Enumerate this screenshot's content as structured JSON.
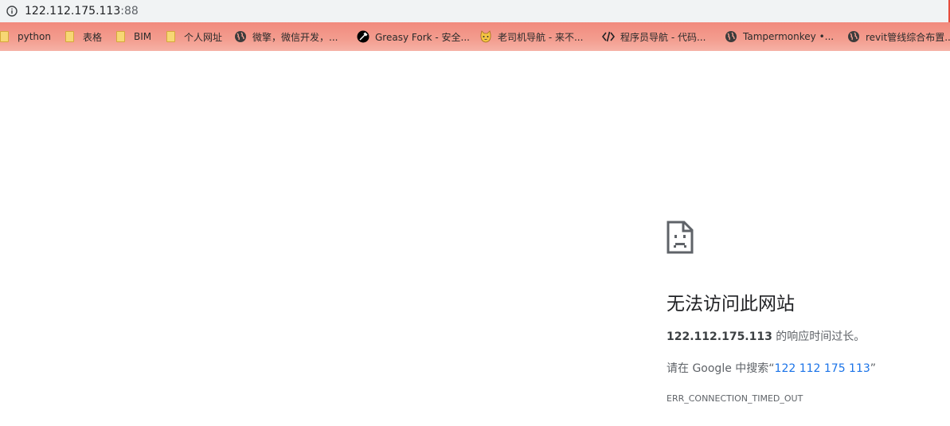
{
  "address_bar": {
    "host": "122.112.175.113",
    "port": ":88"
  },
  "bookmarks": [
    {
      "label": "python",
      "icon": "folder-icon"
    },
    {
      "label": "表格",
      "icon": "folder-icon"
    },
    {
      "label": "BIM",
      "icon": "folder-icon"
    },
    {
      "label": "个人网址",
      "icon": "folder-icon"
    },
    {
      "label": "微擎，微信开发，...",
      "icon": "globe-icon"
    },
    {
      "label": "Greasy Fork - 安全...",
      "icon": "greasyfork-icon"
    },
    {
      "label": "老司机导航 - 来不...",
      "icon": "cat-face-icon"
    },
    {
      "label": "程序员导航 - 代码...",
      "icon": "code-brackets-icon"
    },
    {
      "label": "Tampermonkey •...",
      "icon": "globe-icon"
    },
    {
      "label": "revit管线综合布置...",
      "icon": "globe-icon"
    }
  ],
  "error": {
    "title": "无法访问此网站",
    "host": "122.112.175.113",
    "desc_suffix": " 的响应时间过长。",
    "search_prefix": "请在 Google 中搜索“",
    "search_link": "122 112 175 113",
    "search_suffix": "”",
    "code": "ERR_CONNECTION_TIMED_OUT"
  },
  "colors": {
    "bookmark_bar_top": "#f28a7d",
    "bookmark_bar_bottom": "#f6b2a6",
    "link": "#1a73e8",
    "address_bar": "#f1f3f4"
  }
}
